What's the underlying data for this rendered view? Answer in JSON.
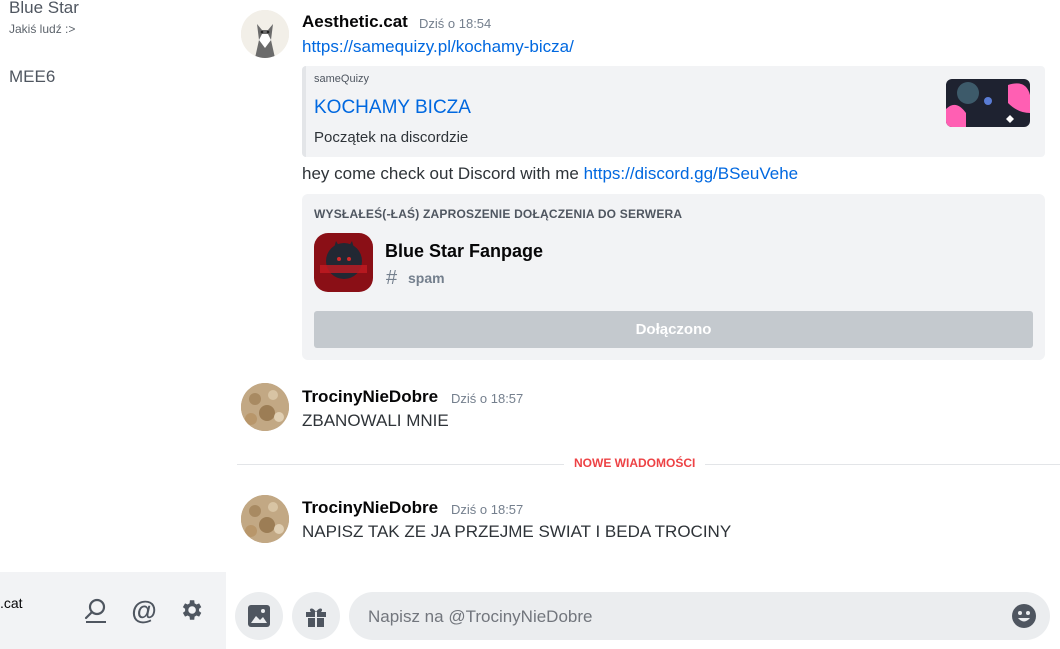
{
  "sidebar": {
    "dms": [
      {
        "name": "Blue Star",
        "subtitle": "Jakiś ludź :>"
      },
      {
        "name": "MEE6"
      }
    ],
    "user_panel": {
      "username": ".cat",
      "icons": [
        "search-icon",
        "mention-icon",
        "gear-icon"
      ]
    }
  },
  "messages": [
    {
      "author": "Aesthetic.cat",
      "time": "Dziś o 18:54",
      "link": "https://samequizy.pl/kochamy-bicza/",
      "embed": {
        "provider": "sameQuizy",
        "title": "KOCHAMY BICZA",
        "description": "Początek na discordzie"
      },
      "text": "hey come check out Discord with me",
      "text_link": "https://discord.gg/BSeuVehe",
      "invite": {
        "header": "WYSŁAŁEŚ(-ŁAŚ) ZAPROSZENIE DOŁĄCZENIA DO SERWERA",
        "server_name": "Blue Star Fanpage",
        "channel": "spam",
        "button": "Dołączono"
      }
    },
    {
      "author": "TrocinyNieDobre",
      "time": "Dziś o 18:57",
      "text": "ZBANOWALI MNIE"
    },
    {
      "author": "TrocinyNieDobre",
      "time": "Dziś o 18:57",
      "text": "NAPISZ TAK ZE JA PRZEJME SWIAT I BEDA TROCINY"
    }
  ],
  "divider": {
    "label": "NOWE WIADOMOŚCI",
    "color": "#ed4245"
  },
  "composer": {
    "placeholder": "Napisz na @TrocinyNieDobre",
    "buttons": [
      "image-icon",
      "gift-icon",
      "emoji-icon"
    ]
  },
  "colors": {
    "link": "#0068e0",
    "accent": "#ed4245"
  }
}
